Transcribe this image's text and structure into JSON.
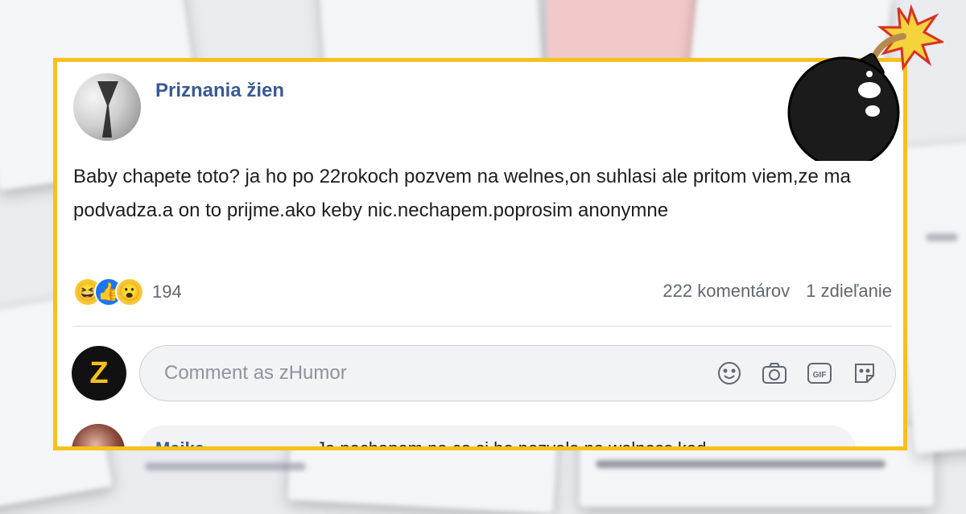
{
  "post": {
    "page_name": "Priznania žien",
    "text": "Baby chapete toto? ja ho po 22rokoch pozvem na welnes,on suhlasi ale pritom viem,ze ma podvadza.a on to prijme.ako keby nic.nechapem.poprosim anonymne",
    "reactions": [
      {
        "type": "haha",
        "icon": "😆"
      },
      {
        "type": "like",
        "icon": "👍"
      },
      {
        "type": "wow",
        "icon": "😮"
      }
    ],
    "reaction_count": "194",
    "comments_count": "222 komentárov",
    "shares_count": "1 zdieľanie"
  },
  "composer": {
    "placeholder": "Comment as zHumor",
    "icons": [
      "smiley-icon",
      "camera-icon",
      "gif-icon",
      "sticker-icon"
    ],
    "avatar_letter": "Z",
    "gif_label": "GIF"
  },
  "next_comment": {
    "author": "Majka",
    "text": "Ja nechapem na co si ho pozvala na welness ked"
  },
  "colors": {
    "frame": "#f7c11b",
    "brand": "#3b5998",
    "like_blue": "#1877f2"
  }
}
